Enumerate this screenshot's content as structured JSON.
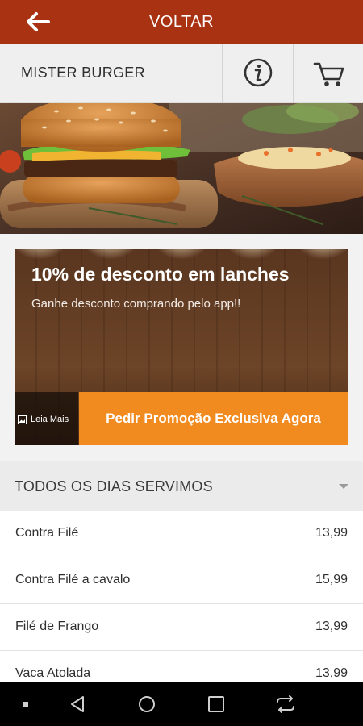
{
  "topbar": {
    "back_icon": "arrow-left-icon",
    "title": "VOLTAR",
    "background": "#a83212"
  },
  "store": {
    "name": "MISTER BURGER",
    "info_icon": "info-icon",
    "cart_icon": "cart-icon"
  },
  "hero": {
    "description_icon": "burger-photo"
  },
  "promo": {
    "title": "10% de desconto em lanches",
    "subtitle": "Ganhe desconto comprando pelo app!!",
    "read_more": "Leia Mais",
    "cta": "Pedir Promoção Exclusiva Agora",
    "cta_color": "#f18a1f"
  },
  "menu": {
    "section_title": "TODOS OS DIAS SERVIMOS",
    "items": [
      {
        "name": "Contra Filé",
        "price": "13,99"
      },
      {
        "name": "Contra Filé a cavalo",
        "price": "15,99"
      },
      {
        "name": "Filé de Frango",
        "price": "13,99"
      },
      {
        "name": "Vaca Atolada",
        "price": "13,99"
      }
    ]
  },
  "navbar": {
    "buttons": [
      "dot-icon",
      "back-triangle-icon",
      "home-circle-icon",
      "recents-square-icon",
      "switch-icon"
    ]
  }
}
